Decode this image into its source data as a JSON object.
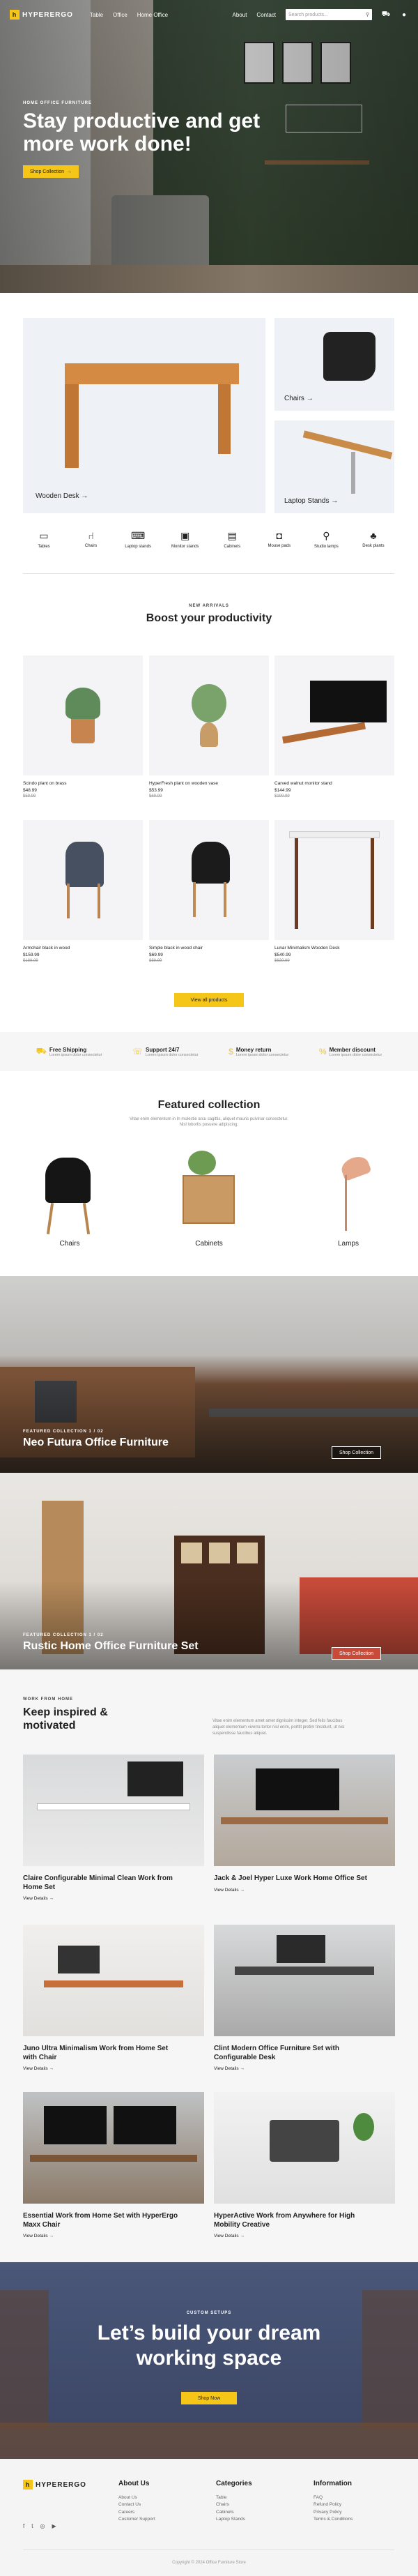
{
  "header": {
    "brand": "HYPERERGO",
    "nav": [
      "Table",
      "Office",
      "Home Office"
    ],
    "right_links": [
      "About",
      "Contact"
    ],
    "search_placeholder": "Search products..."
  },
  "hero": {
    "eyebrow": "HOME OFFICE FURNITURE",
    "title_line1": "Stay productive and get",
    "title_line2": "more work done!",
    "cta": "Shop Collection"
  },
  "categories_big": [
    {
      "label": "Wooden Desk"
    },
    {
      "label": "Chairs"
    },
    {
      "label": "Laptop Stands"
    }
  ],
  "category_icons": [
    "Tables",
    "Chairs",
    "Laptop stands",
    "Monitor stands",
    "Cabinets",
    "Mouse pads",
    "Studio lamps",
    "Desk plants"
  ],
  "products_section": {
    "eyebrow": "NEW ARRIVALS",
    "title": "Boost your productivity",
    "cta": "View all products"
  },
  "products": [
    {
      "name": "Scindo plant on brass",
      "price": "$48.99",
      "old": "$59.99"
    },
    {
      "name": "HyperFresh plant on wooden vase",
      "price": "$53.99",
      "old": "$69.99"
    },
    {
      "name": "Carved walnut monitor stand",
      "price": "$144.99",
      "old": "$199.99"
    },
    {
      "name": "Armchair black in wood",
      "price": "$159.99",
      "old": "$189.99"
    },
    {
      "name": "Simple black in wood chair",
      "price": "$69.99",
      "old": "$89.99"
    },
    {
      "name": "Lunar Minimalism Wooden Desk",
      "price": "$540.99",
      "old": "$639.99"
    }
  ],
  "features": [
    {
      "title": "Free Shipping",
      "sub": "Lorem ipsum dolor consectetur"
    },
    {
      "title": "Support 24/7",
      "sub": "Lorem ipsum dolor consectetur"
    },
    {
      "title": "Money return",
      "sub": "Lorem ipsum dolor consectetur"
    },
    {
      "title": "Member discount",
      "sub": "Lorem ipsum dolor consectetur"
    }
  ],
  "featured": {
    "title": "Featured collection",
    "desc_line1": "Vitae enim elementum in In molestie arcu sagittis, aliquet mauris pulvinar consectetur.",
    "desc_line2": "Nisl lobortis posuere adipiscing.",
    "items": [
      "Chairs",
      "Cabinets",
      "Lamps"
    ]
  },
  "collections": [
    {
      "eyebrow": "FEATURED COLLECTION 1 / 02",
      "title": "Neo Futura Office Furniture",
      "cta": "Shop Collection"
    },
    {
      "eyebrow": "FEATURED COLLECTION 1 / 02",
      "title": "Rustic Home Office Furniture Set",
      "cta": "Shop Collection"
    }
  ],
  "blog": {
    "eyebrow": "WORK FROM HOME",
    "title_line1": "Keep inspired &",
    "title_line2": "motivated",
    "desc_line1": "Vitae enim elementum amet amet dignissim integer. Sed felis faucibus",
    "desc_line2": "aliquet elementum viverra tortor nisl enim, porttit pretim tincidunt, ut nisi",
    "desc_line3": "suspendisse faucibus aliquet.",
    "view_label": "View Details",
    "posts": [
      {
        "l1": "Claire Configurable Minimal Clean Work from",
        "l2": "Home Set"
      },
      {
        "l1": "Jack & Joel Hyper Luxe Work Home Office Set",
        "l2": ""
      },
      {
        "l1": "Juno Ultra Minimalism Work from Home Set",
        "l2": "with Chair"
      },
      {
        "l1": "Clint Modern Office Furniture Set with",
        "l2": "Configurable Desk"
      },
      {
        "l1": "Essential Work from Home Set with HyperErgo",
        "l2": "Maxx Chair"
      },
      {
        "l1": "HyperActive Work from Anywhere for High",
        "l2": "Mobility Creative"
      }
    ]
  },
  "cta_banner": {
    "eyebrow": "CUSTOM SETUPS",
    "title_line1": "Let’s build your dream",
    "title_line2": "working space",
    "cta": "Shop Now"
  },
  "footer": {
    "brand": "HYPERERGO",
    "cols": [
      {
        "title": "About Us",
        "links": [
          "About Us",
          "Contact Us",
          "Careers",
          "Customer Support"
        ]
      },
      {
        "title": "Categories",
        "links": [
          "Table",
          "Chairs",
          "Cabinets",
          "Laptop Stands"
        ]
      },
      {
        "title": "Information",
        "links": [
          "FAQ",
          "Refund Policy",
          "Privacy Policy",
          "Terms & Conditions"
        ]
      }
    ],
    "copyright": "Copyright © 2024 Office Furniture Store"
  },
  "colors": {
    "accent": "#f5c518",
    "dark": "#222222",
    "banner_blue": "#3e4a68"
  }
}
